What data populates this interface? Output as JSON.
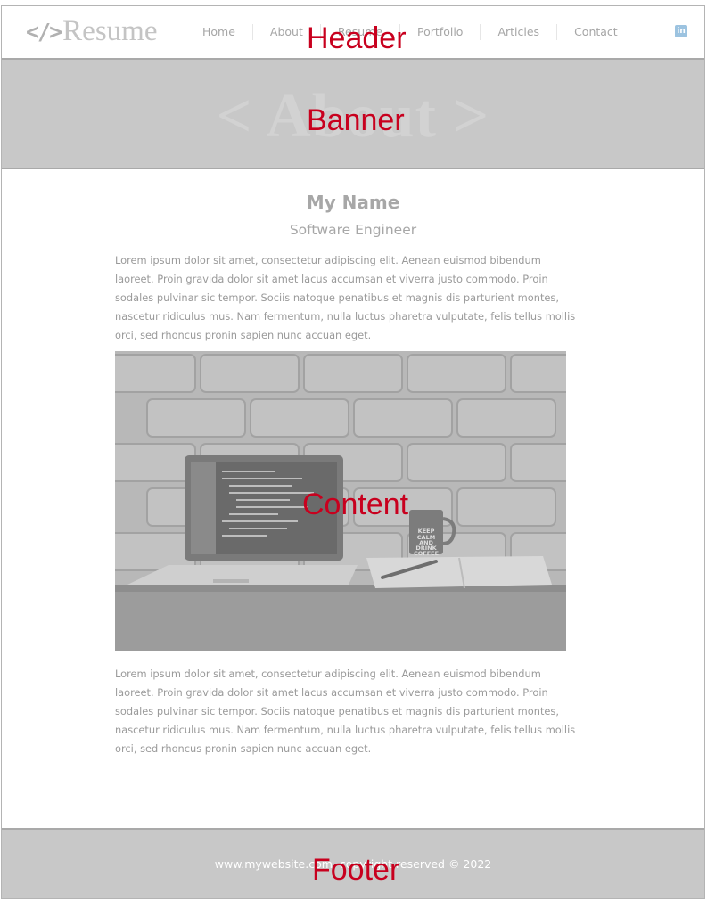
{
  "header": {
    "logo_mark": "</>",
    "logo_text": "Resume",
    "nav": [
      "Home",
      "About",
      "Resume",
      "Portfolio",
      "Articles",
      "Contact"
    ],
    "social_icon": "linkedin-icon",
    "social_glyph": "in"
  },
  "banner": {
    "title": "< About >"
  },
  "content": {
    "name": "My Name",
    "role": "Software Engineer",
    "paragraph_1": "Lorem ipsum dolor sit amet, consectetur adipiscing elit. Aenean euismod bibendum laoreet. Proin gravida dolor sit amet lacus accumsan et viverra justo commodo. Proin sodales pulvinar sic tempor. Sociis natoque penatibus et magnis dis parturient montes, nascetur ridiculus mus. Nam fermentum, nulla luctus pharetra vulputate, felis tellus mollis orci, sed rhoncus pronin sapien nunc accuan eget.",
    "paragraph_2": "Lorem ipsum dolor sit amet, consectetur adipiscing elit. Aenean euismod bibendum laoreet. Proin gravida dolor sit amet lacus accumsan et viverra justo commodo. Proin sodales pulvinar sic tempor. Sociis natoque penatibus et magnis dis parturient montes, nascetur ridiculus mus. Nam fermentum, nulla luctus pharetra vulputate, felis tellus mollis orci, sed rhoncus pronin sapien nunc accuan eget.",
    "mug_text": [
      "KEEP",
      "CALM",
      "AND",
      "DRINK",
      "COFFEE"
    ]
  },
  "footer": {
    "text": "www.mywebsite.com, copyright reserved © 2022"
  },
  "overlays": {
    "header": "Header",
    "banner": "Banner",
    "content": "Content",
    "footer": "Footer"
  }
}
